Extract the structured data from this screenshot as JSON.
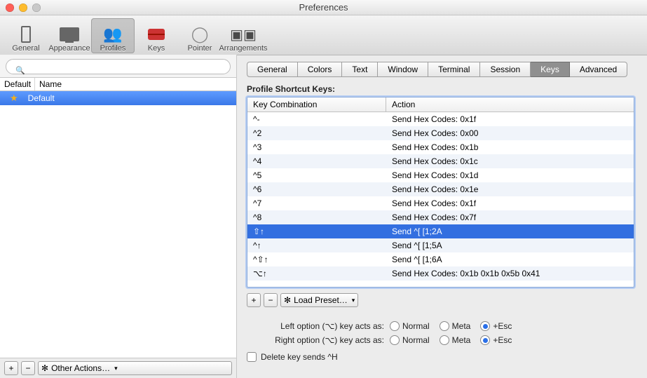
{
  "window": {
    "title": "Preferences"
  },
  "toolbar": [
    {
      "id": "general",
      "label": "General"
    },
    {
      "id": "appearance",
      "label": "Appearance"
    },
    {
      "id": "profiles",
      "label": "Profiles",
      "selected": true
    },
    {
      "id": "keys",
      "label": "Keys"
    },
    {
      "id": "pointer",
      "label": "Pointer"
    },
    {
      "id": "arrangements",
      "label": "Arrangements"
    }
  ],
  "sidebar": {
    "search_placeholder": "",
    "headers": {
      "default": "Default",
      "name": "Name"
    },
    "profiles": [
      {
        "name": "Default",
        "starred": true,
        "selected": true
      }
    ],
    "footer": {
      "plus": "+",
      "minus": "−",
      "other_actions": "Other Actions…"
    }
  },
  "tabs": [
    {
      "label": "General"
    },
    {
      "label": "Colors"
    },
    {
      "label": "Text"
    },
    {
      "label": "Window"
    },
    {
      "label": "Terminal"
    },
    {
      "label": "Session"
    },
    {
      "label": "Keys",
      "active": true
    },
    {
      "label": "Advanced"
    }
  ],
  "section_title": "Profile Shortcut Keys:",
  "table": {
    "headers": {
      "key": "Key Combination",
      "action": "Action"
    },
    "rows": [
      {
        "key": "^-",
        "action": "Send Hex Codes: 0x1f"
      },
      {
        "key": "^2",
        "action": "Send Hex Codes: 0x00"
      },
      {
        "key": "^3",
        "action": "Send Hex Codes: 0x1b"
      },
      {
        "key": "^4",
        "action": "Send Hex Codes: 0x1c"
      },
      {
        "key": "^5",
        "action": "Send Hex Codes: 0x1d"
      },
      {
        "key": "^6",
        "action": "Send Hex Codes: 0x1e"
      },
      {
        "key": "^7",
        "action": "Send Hex Codes: 0x1f"
      },
      {
        "key": "^8",
        "action": "Send Hex Codes: 0x7f"
      },
      {
        "key": "⇧↑",
        "action": "Send ^[ [1;2A",
        "selected": true
      },
      {
        "key": "^↑",
        "action": "Send ^[ [1;5A"
      },
      {
        "key": "^⇧↑",
        "action": "Send ^[ [1;6A"
      },
      {
        "key": "⌥↑",
        "action": "Send Hex Codes: 0x1b 0x1b 0x5b 0x41"
      }
    ]
  },
  "table_buttons": {
    "plus": "+",
    "minus": "−",
    "load_preset": "Load Preset…"
  },
  "options": {
    "left_label": "Left option (⌥) key acts as:",
    "right_label": "Right option (⌥) key acts as:",
    "radio_normal": "Normal",
    "radio_meta": "Meta",
    "radio_esc": "+Esc",
    "left_value": "esc",
    "right_value": "esc",
    "delete_label": "Delete key sends ^H",
    "delete_checked": false
  }
}
